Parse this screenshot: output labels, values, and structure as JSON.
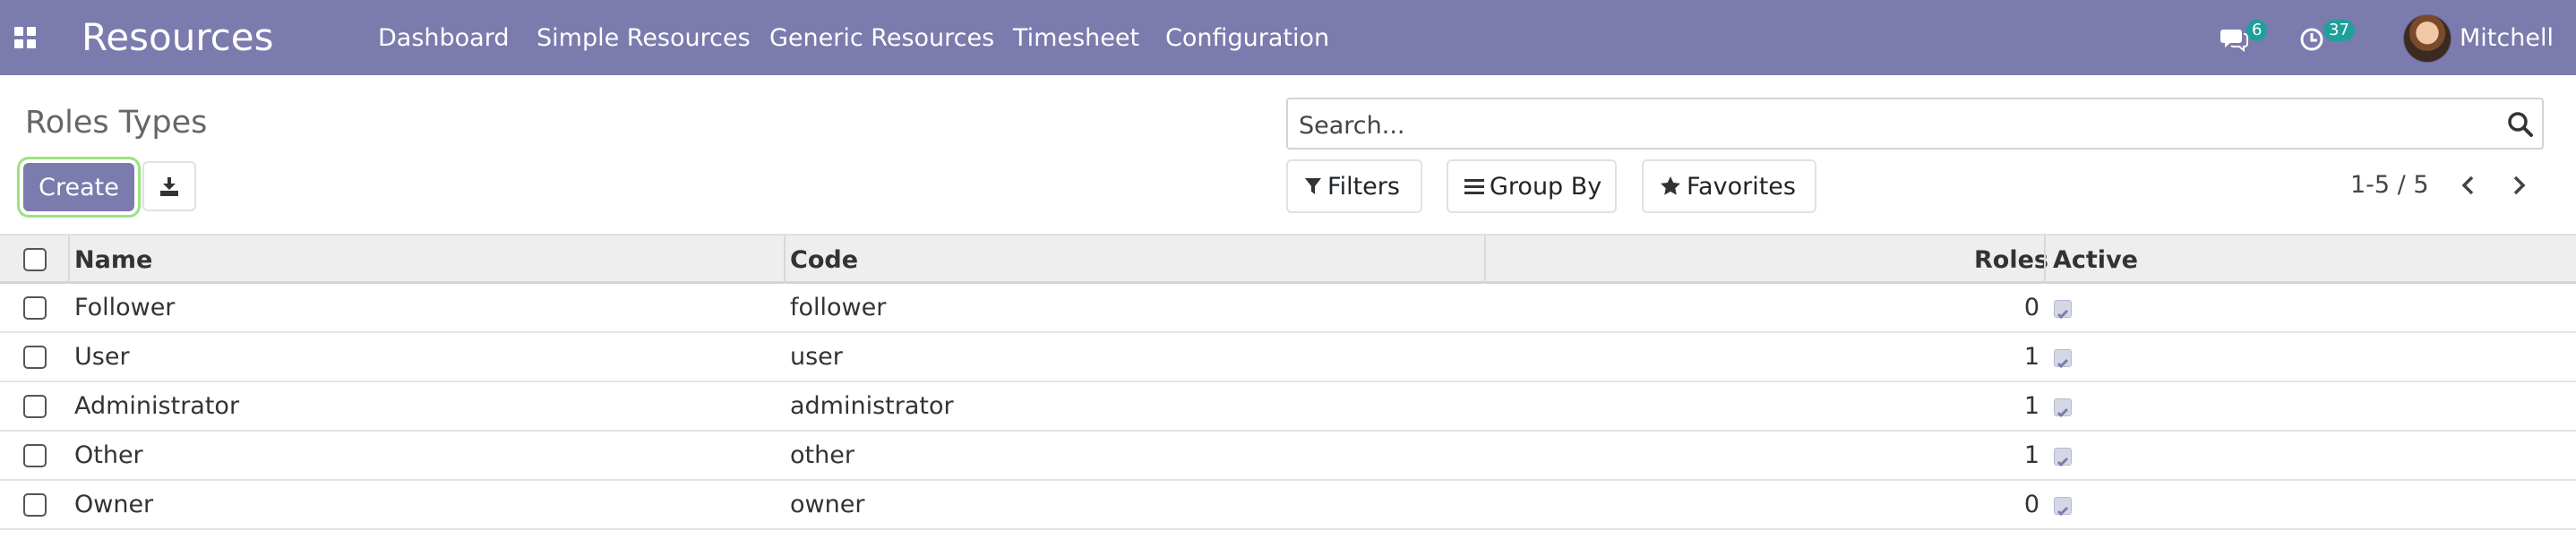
{
  "navbar": {
    "brand": "Resources",
    "menu": [
      "Dashboard",
      "Simple Resources",
      "Generic Resources",
      "Timesheet",
      "Configuration"
    ],
    "messages_count": "6",
    "activities_count": "37",
    "user_name": "Mitchell",
    "accent_color": "#7c7bad",
    "badge_color": "#20a09a"
  },
  "control_panel": {
    "title": "Roles Types",
    "create_label": "Create",
    "search_placeholder": "Search...",
    "filters_label": "Filters",
    "groupby_label": "Group By",
    "favorites_label": "Favorites",
    "pager": "1-5 / 5"
  },
  "table": {
    "columns": [
      "Name",
      "Code",
      "Roles",
      "Active"
    ],
    "rows": [
      {
        "name": "Follower",
        "code": "follower",
        "roles": "0",
        "active": true
      },
      {
        "name": "User",
        "code": "user",
        "roles": "1",
        "active": true
      },
      {
        "name": "Administrator",
        "code": "administrator",
        "roles": "1",
        "active": true
      },
      {
        "name": "Other",
        "code": "other",
        "roles": "1",
        "active": true
      },
      {
        "name": "Owner",
        "code": "owner",
        "roles": "0",
        "active": true
      }
    ]
  }
}
